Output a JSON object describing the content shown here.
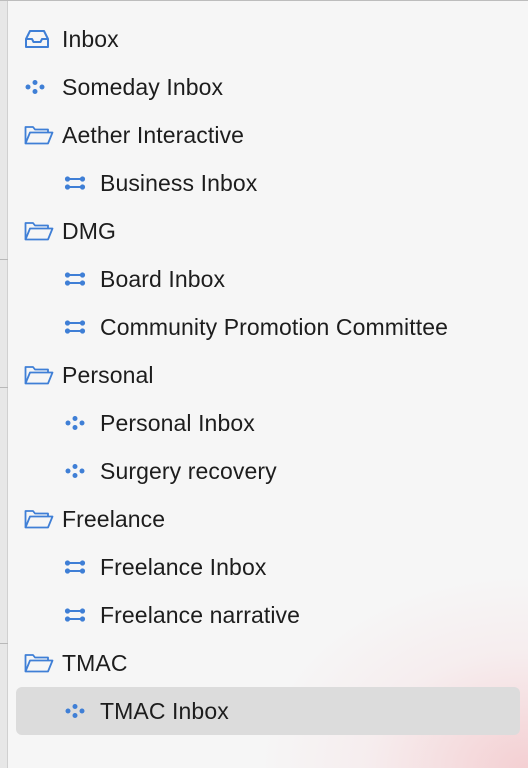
{
  "colors": {
    "icon_blue": "#3f7fd6",
    "text": "#1d1d1d",
    "selected_bg": "#dcdcdc"
  },
  "sidebar": {
    "items": [
      {
        "label": "Inbox",
        "icon": "inbox-tray-icon",
        "level": 0
      },
      {
        "label": "Someday Inbox",
        "icon": "dots-cluster-icon",
        "level": 0
      },
      {
        "label": "Aether Interactive",
        "icon": "folder-icon",
        "level": 0
      },
      {
        "label": "Business Inbox",
        "icon": "shared-link-icon",
        "level": 1
      },
      {
        "label": "DMG",
        "icon": "folder-icon",
        "level": 0
      },
      {
        "label": "Board Inbox",
        "icon": "shared-link-icon",
        "level": 1
      },
      {
        "label": "Community Promotion Committee",
        "icon": "shared-link-icon",
        "level": 1
      },
      {
        "label": "Personal",
        "icon": "folder-icon",
        "level": 0
      },
      {
        "label": "Personal Inbox",
        "icon": "dots-cluster-icon",
        "level": 1
      },
      {
        "label": "Surgery recovery",
        "icon": "dots-cluster-icon",
        "level": 1
      },
      {
        "label": "Freelance",
        "icon": "folder-icon",
        "level": 0
      },
      {
        "label": "Freelance Inbox",
        "icon": "shared-link-icon",
        "level": 1
      },
      {
        "label": "Freelance narrative",
        "icon": "shared-link-icon",
        "level": 1
      },
      {
        "label": "TMAC",
        "icon": "folder-icon",
        "level": 0
      },
      {
        "label": "TMAC Inbox",
        "icon": "dots-cluster-icon",
        "level": 1,
        "selected": true
      }
    ]
  }
}
